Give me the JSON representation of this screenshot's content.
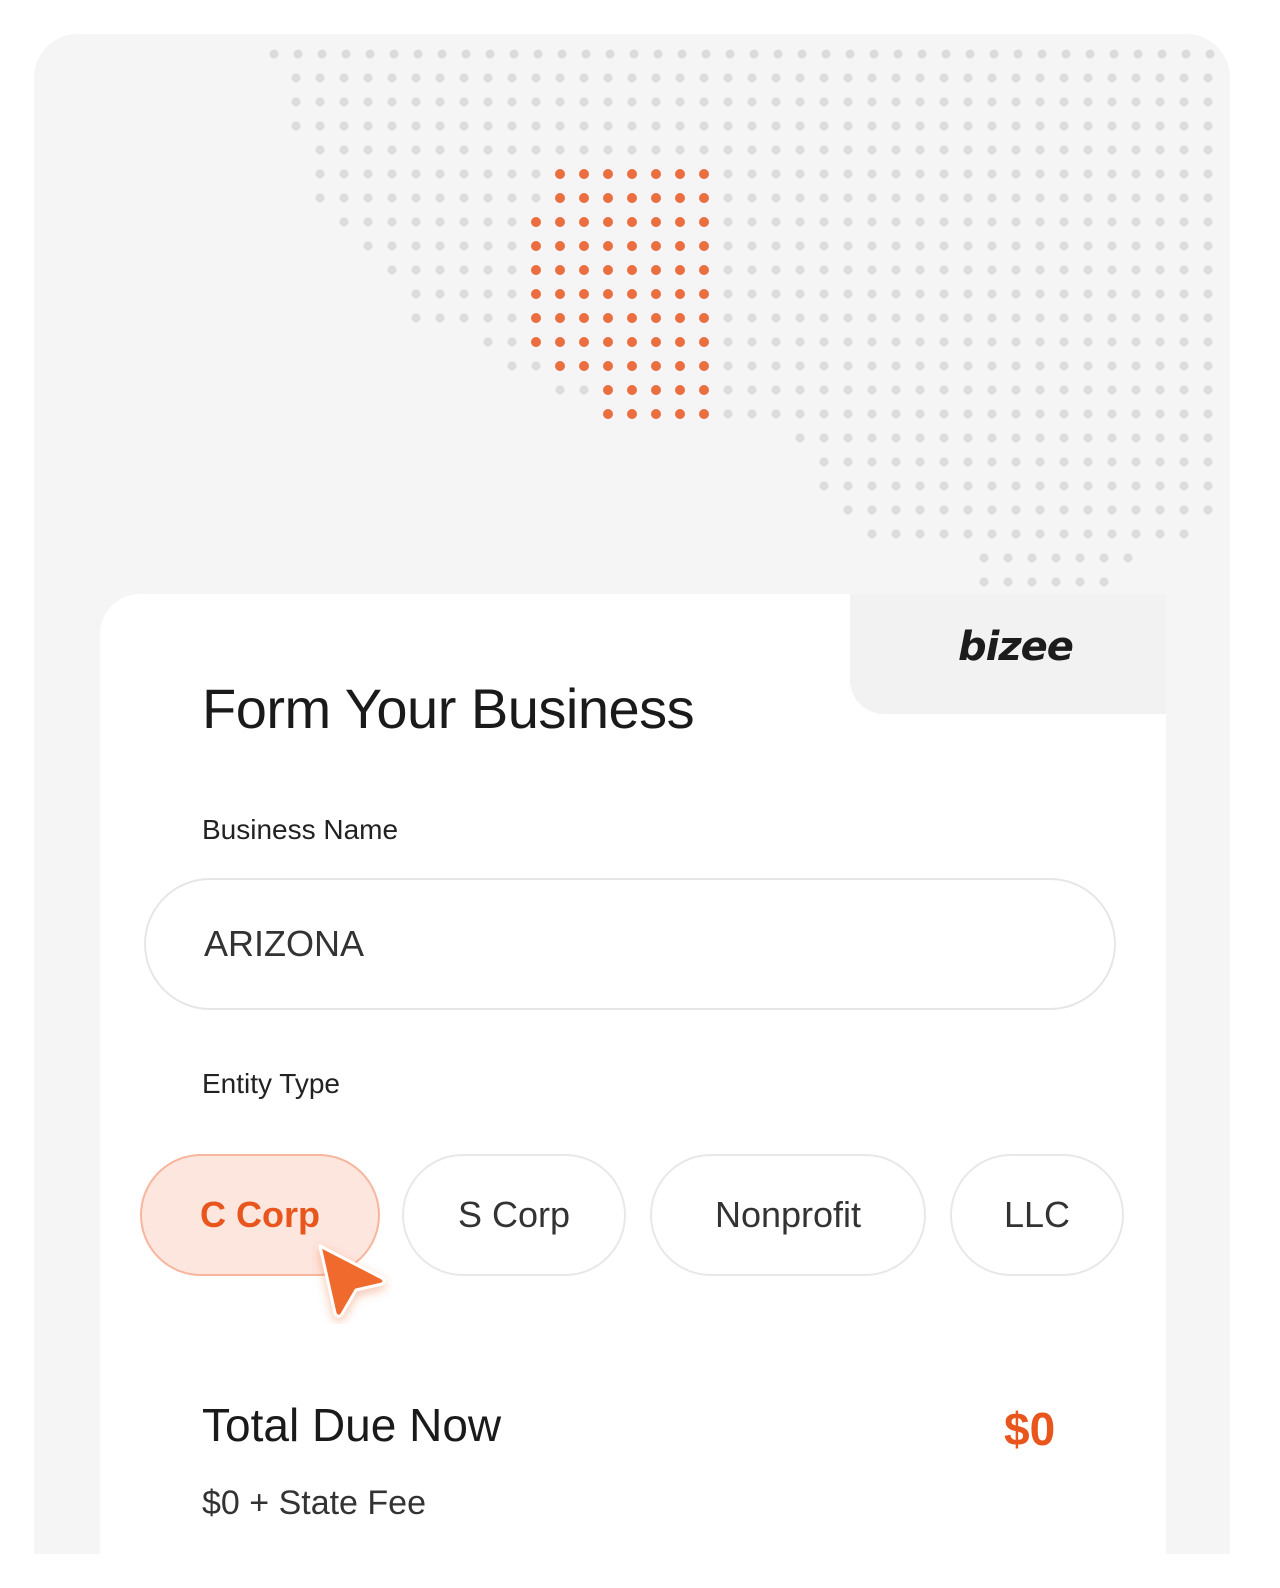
{
  "brand": {
    "logo_text": "bizee",
    "accent_color": "#e8561e"
  },
  "form": {
    "title": "Form Your Business",
    "business_name": {
      "label": "Business Name",
      "value": "ARIZONA"
    },
    "entity_type": {
      "label": "Entity Type",
      "options": [
        "C Corp",
        "S Corp",
        "Nonprofit",
        "LLC"
      ],
      "selected": "C Corp"
    }
  },
  "totals": {
    "label": "Total Due Now",
    "amount": "$0",
    "sub_label": "$0 + State Fee"
  },
  "icons": {
    "cursor": "pointer-arrow-icon",
    "map": "us-dot-map-icon"
  }
}
